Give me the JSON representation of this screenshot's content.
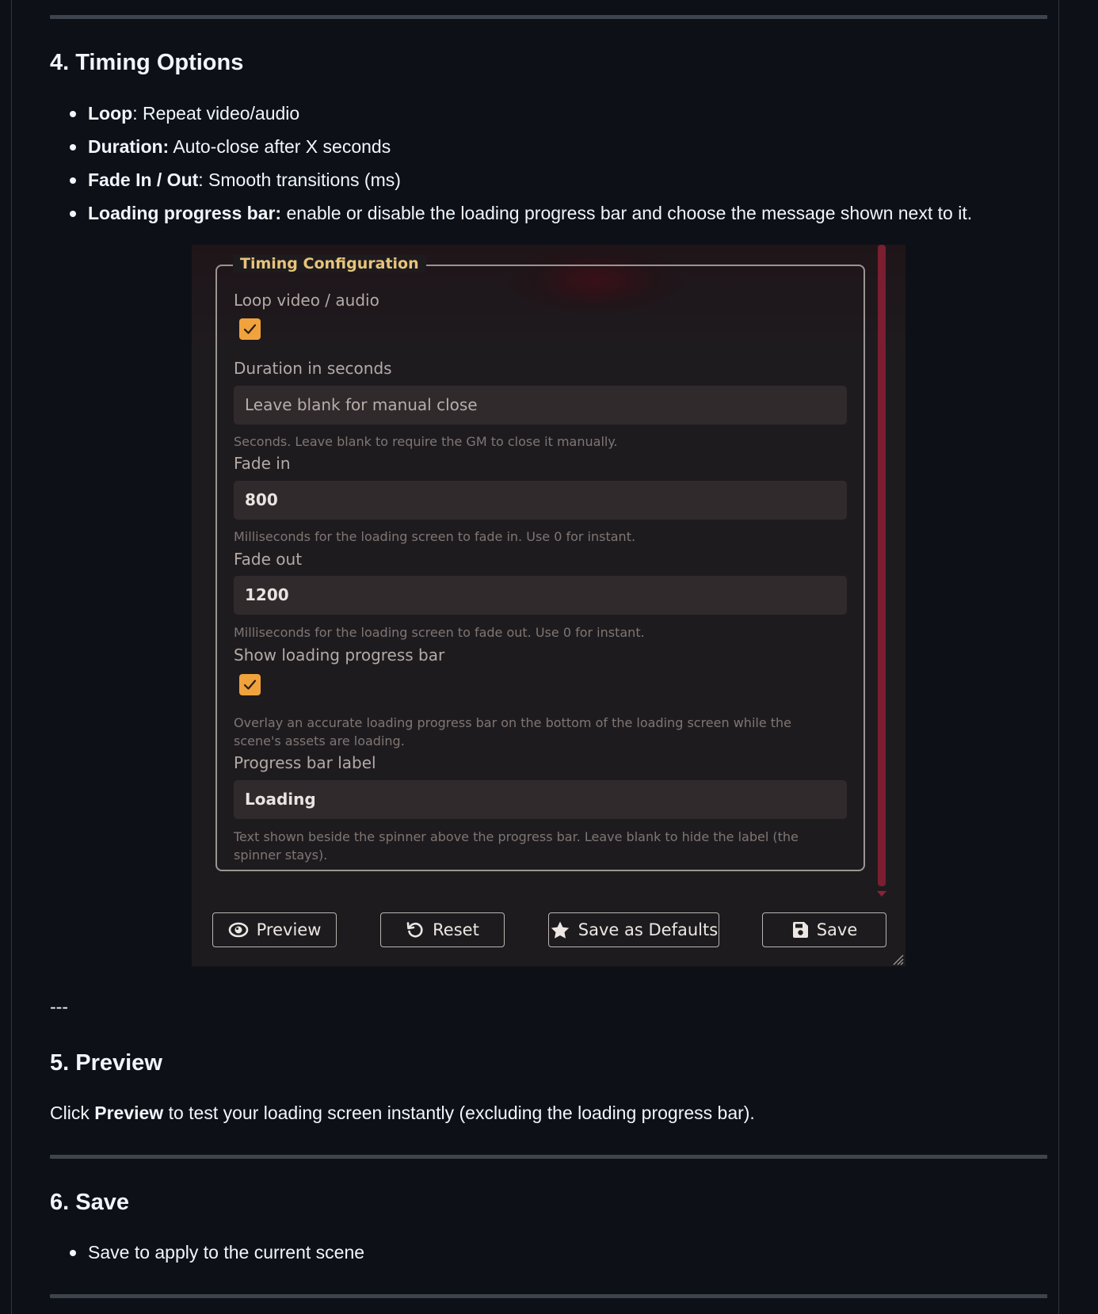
{
  "sections": {
    "timing": {
      "heading": "4. Timing Options",
      "items": [
        {
          "term": "Loop",
          "text": ": Repeat video/audio"
        },
        {
          "term": "Duration:",
          "text": " Auto-close after X seconds"
        },
        {
          "term": "Fade In / Out",
          "text": ": Smooth transitions (ms)"
        },
        {
          "term": "Loading progress bar:",
          "text": " enable or disable the loading progress bar and choose the message shown next to it."
        }
      ]
    },
    "separator": "---",
    "preview": {
      "heading": "5. Preview",
      "text_before": "Click ",
      "bold": "Preview",
      "text_after": " to test your loading screen instantly (excluding the loading progress bar)."
    },
    "save": {
      "heading": "6. Save",
      "items": [
        "Save to apply to the current scene"
      ]
    }
  },
  "screenshot": {
    "legend": "Timing Configuration",
    "loop": {
      "label": "Loop video / audio",
      "checked": true
    },
    "duration": {
      "label": "Duration in seconds",
      "placeholder": "Leave blank for manual close",
      "hint": "Seconds. Leave blank to require the GM to close it manually."
    },
    "fade_in": {
      "label": "Fade in",
      "value": "800",
      "hint": "Milliseconds for the loading screen to fade in. Use 0 for instant."
    },
    "fade_out": {
      "label": "Fade out",
      "value": "1200",
      "hint": "Milliseconds for the loading screen to fade out. Use 0 for instant."
    },
    "progress_bar": {
      "label": "Show loading progress bar",
      "checked": true,
      "hint": "Overlay an accurate loading progress bar on the bottom of the loading screen while the scene's assets are loading."
    },
    "progress_label": {
      "label": "Progress bar label",
      "value": "Loading",
      "hint": "Text shown beside the spinner above the progress bar. Leave blank to hide the label (the spinner stays)."
    },
    "buttons": {
      "preview": "Preview",
      "reset": "Reset",
      "save_defaults": "Save as Defaults",
      "save": "Save"
    },
    "colors": {
      "accent": "#f0a33c",
      "legend": "#e8c47a",
      "scrollbar": "#7a1e30"
    }
  }
}
